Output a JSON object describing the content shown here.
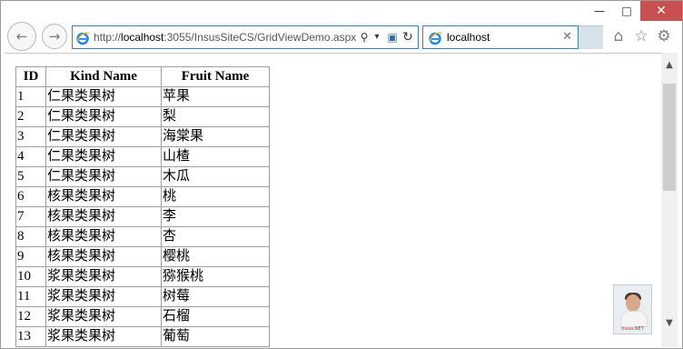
{
  "window": {
    "minimize_glyph": "—",
    "maximize_glyph": "□",
    "close_glyph": "✕"
  },
  "nav": {
    "back_glyph": "←",
    "forward_glyph": "→"
  },
  "address_bar": {
    "url_prefix": "http://",
    "url_host": "localhost",
    "url_rest": ":3055/InsusSiteCS/GridViewDemo.aspx",
    "search_glyph": "⚲",
    "dropdown_glyph": "▾",
    "compat_glyph": "▣",
    "refresh_glyph": "↻"
  },
  "tab": {
    "title": "localhost",
    "close_glyph": "✕"
  },
  "toolbar": {
    "home_glyph": "⌂",
    "favorites_glyph": "☆",
    "settings_glyph": "⚙"
  },
  "scrollbar": {
    "up_glyph": "▲",
    "down_glyph": "▼"
  },
  "grid": {
    "columns": [
      "ID",
      "Kind Name",
      "Fruit Name"
    ],
    "rows": [
      [
        "1",
        "仁果类果树",
        "苹果"
      ],
      [
        "2",
        "仁果类果树",
        "梨"
      ],
      [
        "3",
        "仁果类果树",
        "海棠果"
      ],
      [
        "4",
        "仁果类果树",
        "山楂"
      ],
      [
        "5",
        "仁果类果树",
        "木瓜"
      ],
      [
        "6",
        "核果类果树",
        "桃"
      ],
      [
        "7",
        "核果类果树",
        "李"
      ],
      [
        "8",
        "核果类果树",
        "杏"
      ],
      [
        "9",
        "核果类果树",
        "樱桃"
      ],
      [
        "10",
        "浆果类果树",
        "猕猴桃"
      ],
      [
        "11",
        "浆果类果树",
        "树莓"
      ],
      [
        "12",
        "浆果类果树",
        "石榴"
      ],
      [
        "13",
        "浆果类果树",
        "葡萄"
      ]
    ]
  },
  "avatar": {
    "caption": "Insus.NET"
  },
  "colors": {
    "accent": "#3c7fb1",
    "close_button": "#c75050",
    "grid_border": "#a0a0a0"
  }
}
